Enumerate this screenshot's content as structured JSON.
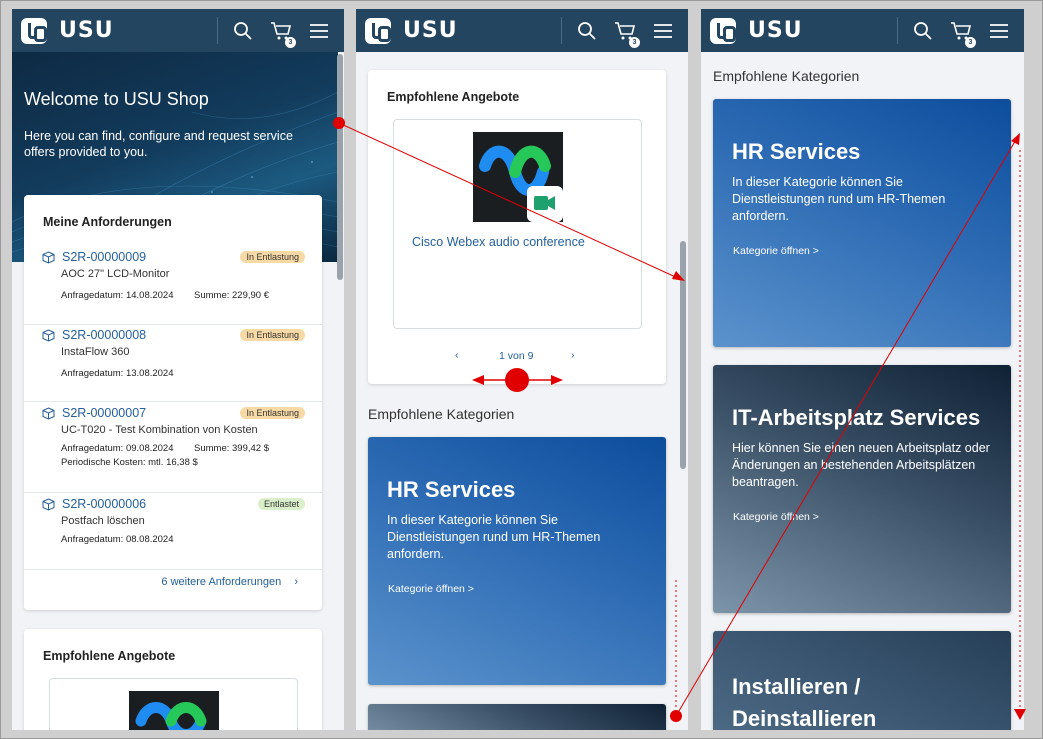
{
  "colors": {
    "topbar": "#24455f",
    "link": "#24609c",
    "pill_in_progress": "#f7d9a6",
    "pill_done": "#d9efc9",
    "annotation": "#e00000"
  },
  "app": {
    "brand": "USU",
    "cart_count": "3",
    "icons": [
      "search-icon",
      "cart-icon",
      "menu-icon"
    ]
  },
  "hero": {
    "title": "Welcome to USU Shop",
    "text": "Here you can find, configure and request service offers provided to you."
  },
  "requests": {
    "title": "Meine Anforderungen",
    "items": [
      {
        "id": "S2R-00000009",
        "name": "AOC 27\" LCD-Monitor",
        "status": "In Entlastung",
        "date": "Anfragedatum: 14.08.2024",
        "sum": "Summe: 229,90 €",
        "periodic": ""
      },
      {
        "id": "S2R-00000008",
        "name": "InstaFlow 360",
        "status": "In Entlastung",
        "date": "Anfragedatum: 13.08.2024",
        "sum": "",
        "periodic": ""
      },
      {
        "id": "S2R-00000007",
        "name": "UC-T020 - Test Kombination von Kosten",
        "status": "In Entlastung",
        "date": "Anfragedatum: 09.08.2024",
        "sum": "Summe: 399,42 $",
        "periodic": "Periodische Kosten: mtl. 16,38 $"
      },
      {
        "id": "S2R-00000006",
        "name": "Postfach löschen",
        "status": "Entlastet",
        "date": "Anfragedatum: 08.08.2024",
        "sum": "",
        "periodic": ""
      }
    ],
    "more": "6 weitere Anforderungen"
  },
  "offers": {
    "title": "Empfohlene Angebote",
    "item_name": "Cisco Webex audio conference",
    "pager": "1 von 9"
  },
  "categories": {
    "title": "Empfohlene Kategorien",
    "open_label": "Kategorie öffnen >",
    "items": [
      {
        "title": "HR Services",
        "desc": "In dieser Kategorie können Sie Dienstleistungen rund um HR-Themen anfordern."
      },
      {
        "title": "IT-Arbeitsplatz Services",
        "desc": "Hier können Sie einen neuen Arbeitsplatz oder Änderungen an bestehenden Arbeitsplätzen beantragen."
      },
      {
        "title": "Installieren / Deinstallieren",
        "desc": ""
      }
    ]
  }
}
